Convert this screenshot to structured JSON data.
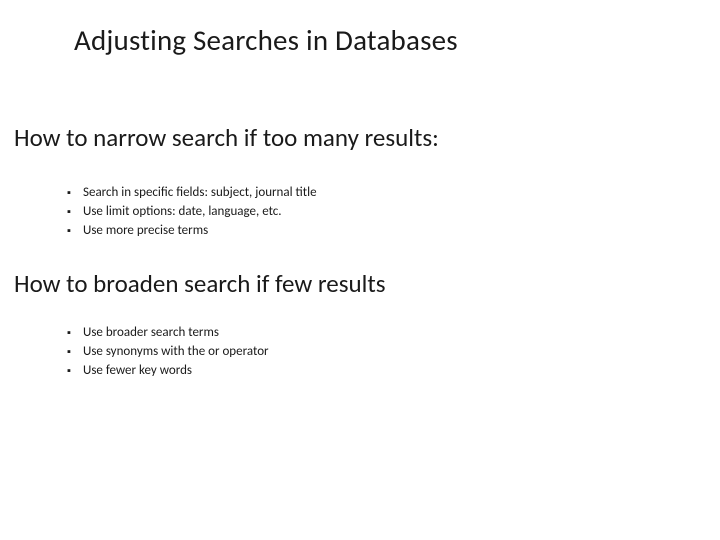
{
  "title": "Adjusting Searches in Databases",
  "sections": {
    "narrow": {
      "heading": "How to narrow search if too many results:",
      "items": [
        "Search in specific fields: subject, journal title",
        "Use limit options: date, language, etc.",
        "Use more precise terms"
      ]
    },
    "broaden": {
      "heading": "How to broaden search if few results",
      "items": [
        "Use broader search terms",
        "Use synonyms with the or operator",
        "Use fewer key words"
      ]
    }
  }
}
